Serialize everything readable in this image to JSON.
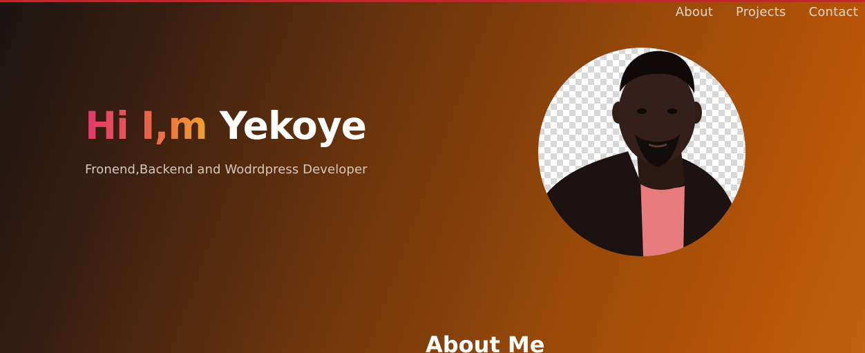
{
  "nav": {
    "items": [
      {
        "label": "About"
      },
      {
        "label": "Projects"
      },
      {
        "label": "Contact"
      }
    ]
  },
  "hero": {
    "greeting": "Hi I,m",
    "name": "Yekoye",
    "subtitle": "Fronend,Backend and Wodrdpress Developer"
  },
  "about": {
    "title": "About Me"
  },
  "colors": {
    "top_bar": "#c0282d",
    "greeting_gradient_start": "#e13a6e",
    "greeting_gradient_end": "#f0a030",
    "background_dark": "#1b1413",
    "background_orange": "#b85508"
  }
}
